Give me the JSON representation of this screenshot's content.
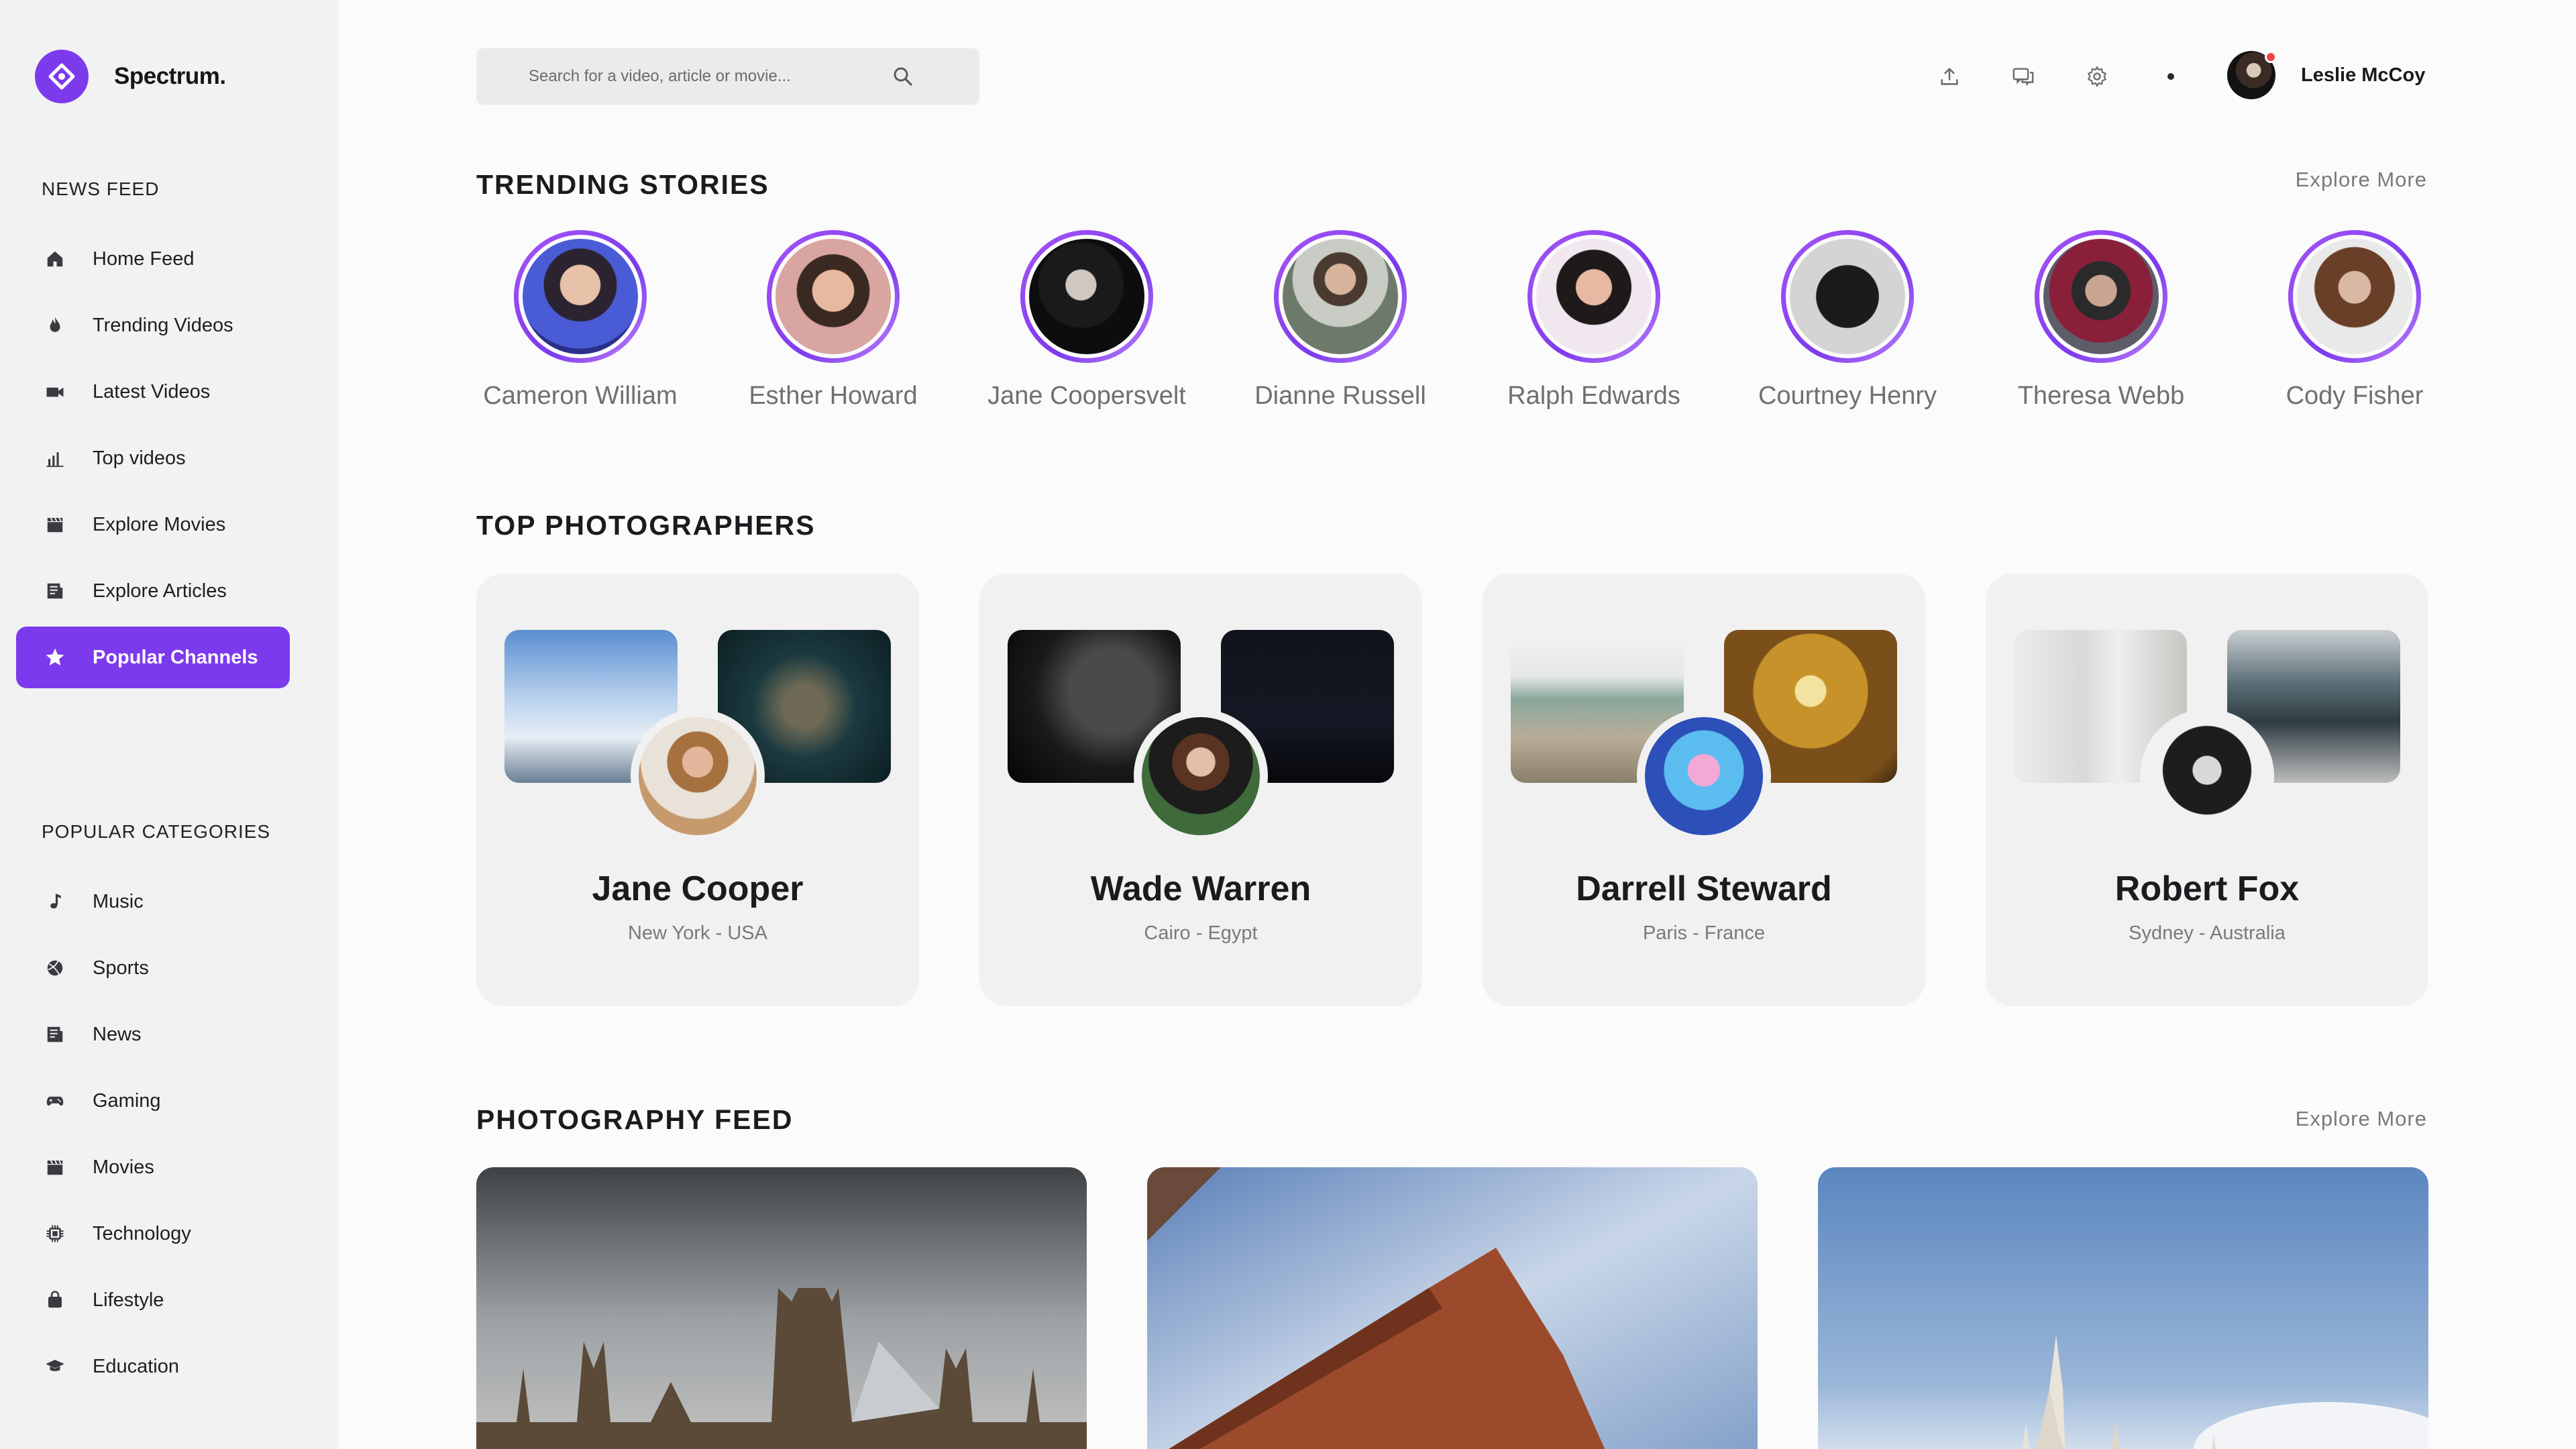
{
  "brand": {
    "name": "Spectrum.",
    "logo_icon": "diamond-logo-icon",
    "accent": "#7c3aed"
  },
  "sidebar": {
    "news_heading": "NEWS FEED",
    "news_items": [
      {
        "label": "Home Feed",
        "icon": "home-icon",
        "active": false
      },
      {
        "label": "Trending Videos",
        "icon": "flame-icon",
        "active": false
      },
      {
        "label": "Latest Videos",
        "icon": "video-camera-icon",
        "active": false
      },
      {
        "label": "Top videos",
        "icon": "bar-chart-icon",
        "active": false
      },
      {
        "label": "Explore Movies",
        "icon": "clapperboard-icon",
        "active": false
      },
      {
        "label": "Explore Articles",
        "icon": "article-icon",
        "active": false
      },
      {
        "label": "Popular Channels",
        "icon": "star-icon",
        "active": true
      }
    ],
    "categories_heading": "POPULAR CATEGORIES",
    "category_items": [
      {
        "label": "Music",
        "icon": "music-note-icon"
      },
      {
        "label": "Sports",
        "icon": "ball-icon"
      },
      {
        "label": "News",
        "icon": "newspaper-icon"
      },
      {
        "label": "Gaming",
        "icon": "gamepad-icon"
      },
      {
        "label": "Movies",
        "icon": "clapperboard-icon"
      },
      {
        "label": "Technology",
        "icon": "chip-icon"
      },
      {
        "label": "Lifestyle",
        "icon": "bag-icon"
      },
      {
        "label": "Education",
        "icon": "graduation-cap-icon"
      }
    ]
  },
  "search": {
    "placeholder": "Search for a video, article or movie..."
  },
  "topbar": {
    "icons": [
      "upload-icon",
      "chat-icon",
      "settings-icon",
      "more-dot-icon"
    ]
  },
  "user": {
    "name": "Leslie McCoy",
    "status_color": "#ef4444"
  },
  "trending": {
    "title": "TRENDING STORIES",
    "explore": "Explore More",
    "stories": [
      {
        "name": "Cameron William"
      },
      {
        "name": "Esther Howard"
      },
      {
        "name": "Jane Coopersvelt"
      },
      {
        "name": "Dianne Russell"
      },
      {
        "name": "Ralph Edwards"
      },
      {
        "name": "Courtney Henry"
      },
      {
        "name": "Theresa Webb"
      },
      {
        "name": "Cody Fisher"
      }
    ]
  },
  "photographers": {
    "title": "TOP PHOTOGRAPHERS",
    "cards": [
      {
        "name": "Jane Cooper",
        "location": "New York - USA"
      },
      {
        "name": "Wade Warren",
        "location": "Cairo - Egypt"
      },
      {
        "name": "Darrell Steward",
        "location": "Paris - France"
      },
      {
        "name": "Robert Fox",
        "location": "Sydney - Australia"
      }
    ]
  },
  "feed": {
    "title": "PHOTOGRAPHY FEED",
    "explore": "Explore More"
  }
}
